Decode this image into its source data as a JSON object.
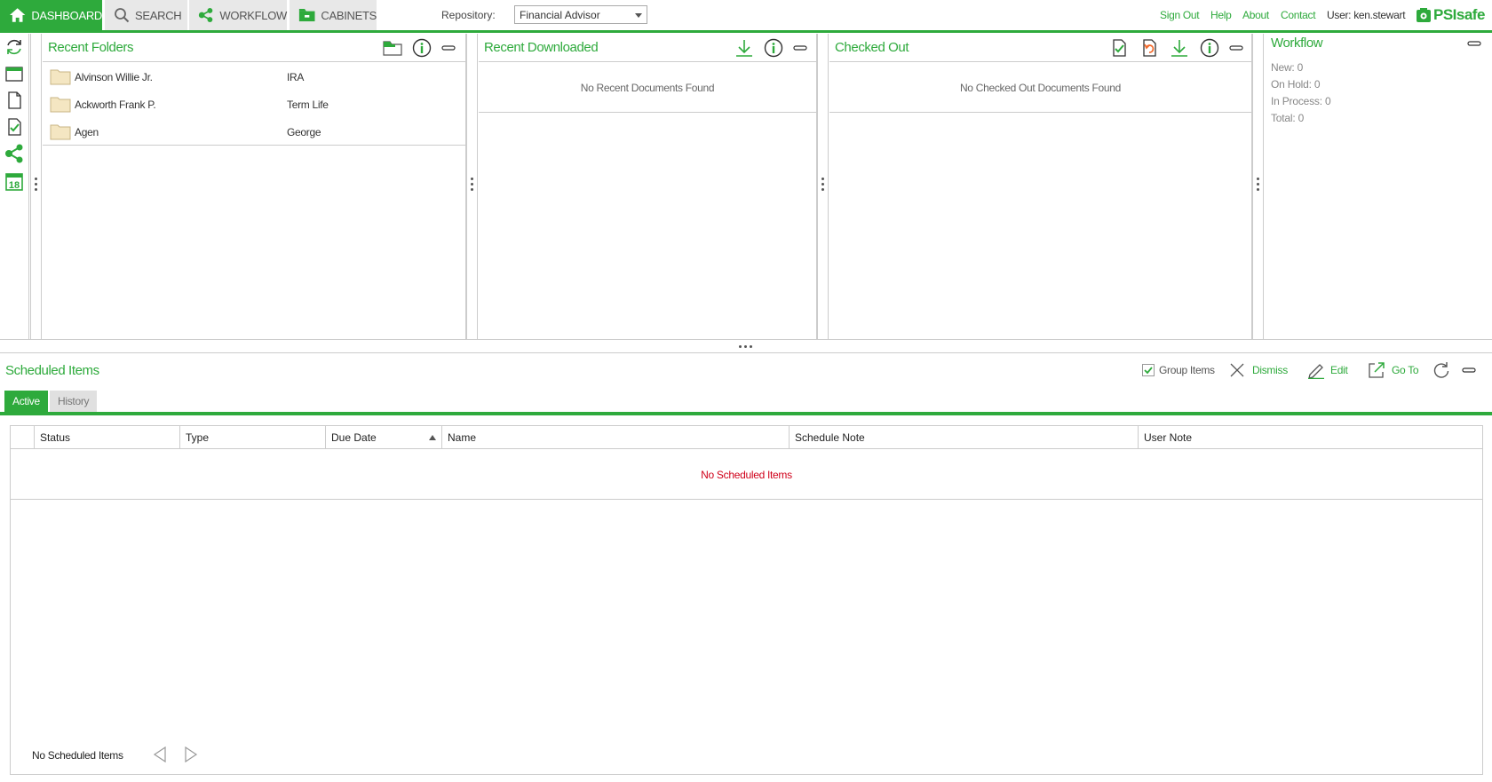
{
  "nav": {
    "tabs": [
      {
        "label": "DASHBOARD",
        "icon": "home-icon",
        "active": true
      },
      {
        "label": "SEARCH",
        "icon": "search-icon",
        "active": false
      },
      {
        "label": "WORKFLOW",
        "icon": "share-icon",
        "active": false
      },
      {
        "label": "CABINETS",
        "icon": "cabinet-icon",
        "active": false
      }
    ],
    "repository_label": "Repository:",
    "repository_value": "Financial Advisor",
    "links": {
      "sign_out": "Sign Out",
      "help": "Help",
      "about": "About",
      "contact": "Contact"
    },
    "user": "User: ken.stewart",
    "logo_text": "PSIsafe"
  },
  "colors": {
    "accent": "#2eaa3c",
    "error": "#d0021b",
    "checkin_orange": "#f36b2c"
  },
  "left_tools": [
    "refresh-icon",
    "folder-view-icon",
    "document-icon",
    "checked-doc-icon",
    "share-icon",
    "calendar-icon"
  ],
  "calendar_day": "18",
  "recent_folders": {
    "title": "Recent Folders",
    "rows": [
      {
        "name": "Alvinson Willie Jr.",
        "type": "IRA"
      },
      {
        "name": "Ackworth Frank P.",
        "type": "Term Life"
      },
      {
        "name": "Agen",
        "type": "George"
      }
    ]
  },
  "recent_downloaded": {
    "title": "Recent Downloaded",
    "empty": "No Recent Documents Found"
  },
  "checked_out": {
    "title": "Checked Out",
    "empty": "No Checked Out Documents Found"
  },
  "workflow": {
    "title": "Workflow",
    "lines": [
      "New: 0",
      "On Hold: 0",
      "In Process: 0",
      "Total: 0"
    ]
  },
  "scheduled": {
    "title": "Scheduled Items",
    "group_items_label": "Group Items",
    "group_items_checked": true,
    "dismiss": "Dismiss",
    "edit": "Edit",
    "go_to": "Go To",
    "tabs": [
      "Active",
      "History"
    ],
    "columns": [
      "Status",
      "Type",
      "Due Date",
      "Name",
      "Schedule Note",
      "User Note"
    ],
    "sorted_column": "Due Date",
    "empty": "No Scheduled Items",
    "footer": "No Scheduled Items"
  }
}
